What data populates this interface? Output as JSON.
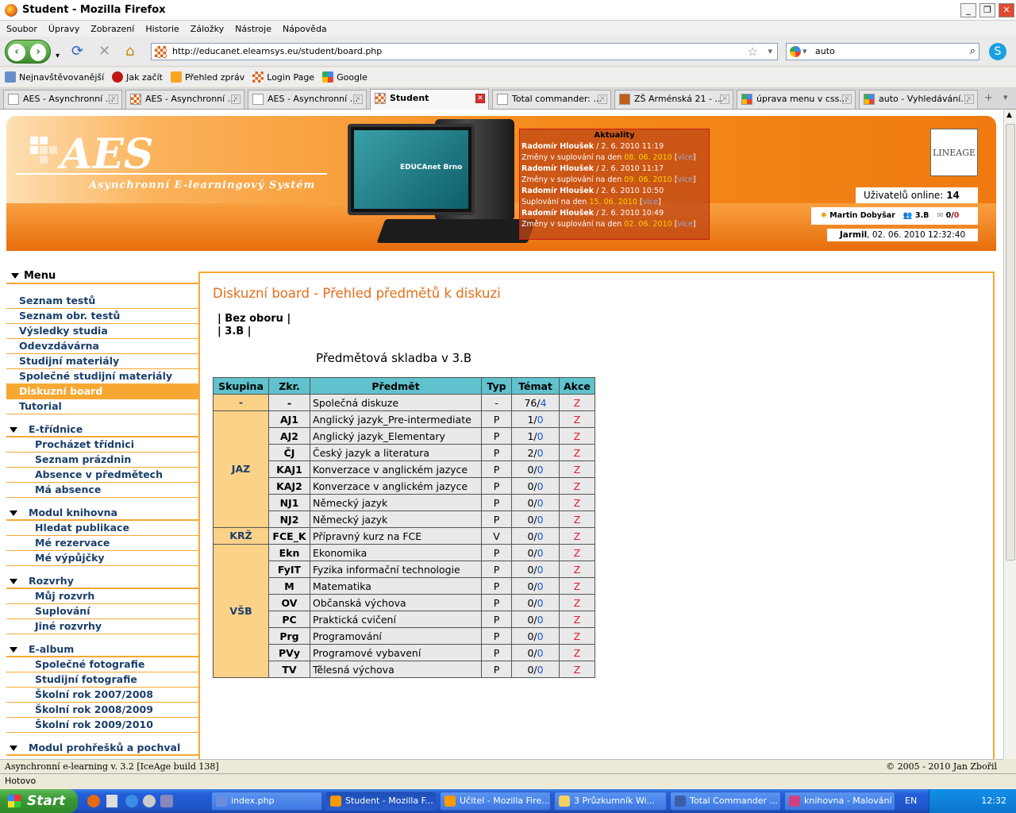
{
  "window": {
    "title": "Student - Mozilla Firefox"
  },
  "menubar": [
    "Soubor",
    "Úpravy",
    "Zobrazení",
    "Historie",
    "Záložky",
    "Nástroje",
    "Nápověda"
  ],
  "url": "http://educanet.elearnsys.eu/student/board.php",
  "search": "auto",
  "bookmarks": [
    "Nejnavštěvovanější",
    "Jak začít",
    "Přehled zpráv",
    "Login Page",
    "Google"
  ],
  "tabs": [
    "AES - Asynchronní ...",
    "AES - Asynchronní ...",
    "AES - Asynchronní ...",
    "Student",
    "Total commander: ...",
    "ZŠ Arménská 21 - ...",
    "úprava menu v css...",
    "auto - Vyhledávání..."
  ],
  "banner": {
    "logo": "AES",
    "subtitle": "Asynchronní E-learningový Systém",
    "monitor_text": "EDUCAnet Brno",
    "lineage": "LINEAGE",
    "news_title": "Aktuality",
    "news": [
      {
        "author": "Radomír Hloušek",
        "date": " / 2. 6. 2010 11:19",
        "text": "Změny v suplování na den ",
        "day": "08. 06. 2010",
        "more": "více"
      },
      {
        "author": "Radomír Hloušek",
        "date": " / 2. 6. 2010 11:17",
        "text": "Změny v suplování na den ",
        "day": "09. 06. 2010",
        "more": "více"
      },
      {
        "author": "Radomír Hloušek",
        "date": " / 2. 6. 2010 10:50",
        "text": "Suplování na den ",
        "day": "15. 06. 2010",
        "more": "více"
      },
      {
        "author": "Radomír Hloušek",
        "date": " / 2. 6. 2010 10:49",
        "text": "Změny v suplování na den ",
        "day": "02. 06. 2010",
        "more": "více"
      }
    ],
    "online_label": "Uživatelů online: ",
    "online_count": "14",
    "user_name": "Martin Dobyšar",
    "user_class": "3.B",
    "messages": "0/",
    "messages_new": "0",
    "date_user": "Jarmil",
    "date_text": ", 02. 06. 2010 12:32:40"
  },
  "sidebar": {
    "menu_title": "Menu",
    "items": [
      "Seznam testů",
      "Seznam obr. testů",
      "Výsledky studia",
      "Odevzdávárna",
      "Studijní materiály",
      "Společné studijní materiály",
      "Diskuzní board",
      "Tutorial"
    ],
    "groups": [
      {
        "title": "E-třídnice",
        "items": [
          "Procházet třídnici",
          "Seznam prázdnin",
          "Absence v předmětech",
          "Má absence"
        ]
      },
      {
        "title": "Modul knihovna",
        "items": [
          "Hledat publikace",
          "Mé rezervace",
          "Mé výpůjčky"
        ]
      },
      {
        "title": "Rozvrhy",
        "items": [
          "Můj rozvrh",
          "Suplování",
          "Jiné rozvrhy"
        ]
      },
      {
        "title": "E-album",
        "items": [
          "Společné fotografie",
          "Studijní fotografie",
          "Školní rok 2007/2008",
          "Školní rok 2008/2009",
          "Školní rok 2009/2010"
        ]
      },
      {
        "title": "Modul prohřešků a pochval",
        "items": []
      }
    ]
  },
  "main": {
    "title": "Diskuzní board - Přehled předmětů k diskuzi",
    "filter1": "Bez oboru",
    "filter2": "3.B",
    "table_title": "Předmětová skladba v 3.B",
    "headers": [
      "Skupina",
      "Zkr.",
      "Předmět",
      "Typ",
      "Témat",
      "Akce"
    ],
    "groups": [
      {
        "name": "-",
        "rows": [
          {
            "k": "-",
            "s": "Společná diskuze",
            "t": "-",
            "a": "76/",
            "n": "4"
          }
        ]
      },
      {
        "name": "JAZ",
        "rows": [
          {
            "k": "AJ1",
            "s": "Anglický jazyk_Pre-intermediate",
            "t": "P",
            "a": "1/",
            "n": "0"
          },
          {
            "k": "AJ2",
            "s": "Anglický jazyk_Elementary",
            "t": "P",
            "a": "1/",
            "n": "0"
          },
          {
            "k": "ČJ",
            "s": "Český jazyk a literatura",
            "t": "P",
            "a": "2/",
            "n": "0"
          },
          {
            "k": "KAJ1",
            "s": "Konverzace v anglickém jazyce",
            "t": "P",
            "a": "0/",
            "n": "0"
          },
          {
            "k": "KAJ2",
            "s": "Konverzace v anglickém jazyce",
            "t": "P",
            "a": "0/",
            "n": "0"
          },
          {
            "k": "NJ1",
            "s": "Německý jazyk",
            "t": "P",
            "a": "0/",
            "n": "0"
          },
          {
            "k": "NJ2",
            "s": "Německý jazyk",
            "t": "P",
            "a": "0/",
            "n": "0"
          }
        ]
      },
      {
        "name": "KRŽ",
        "rows": [
          {
            "k": "FCE_K",
            "s": "Přípravný kurz na FCE",
            "t": "V",
            "a": "0/",
            "n": "0"
          }
        ]
      },
      {
        "name": "VŠB",
        "rows": [
          {
            "k": "Ekn",
            "s": "Ekonomika",
            "t": "P",
            "a": "0/",
            "n": "0"
          },
          {
            "k": "FyIT",
            "s": "Fyzika informační technologie",
            "t": "P",
            "a": "0/",
            "n": "0"
          },
          {
            "k": "M",
            "s": "Matematika",
            "t": "P",
            "a": "0/",
            "n": "0"
          },
          {
            "k": "OV",
            "s": "Občanská výchova",
            "t": "P",
            "a": "0/",
            "n": "0"
          },
          {
            "k": "PC",
            "s": "Praktická cvičení",
            "t": "P",
            "a": "0/",
            "n": "0"
          },
          {
            "k": "Prg",
            "s": "Programování",
            "t": "P",
            "a": "0/",
            "n": "0"
          },
          {
            "k": "PVy",
            "s": "Programové vybavení",
            "t": "P",
            "a": "0/",
            "n": "0"
          },
          {
            "k": "TV",
            "s": "Tělesná výchova",
            "t": "P",
            "a": "0/",
            "n": "0"
          }
        ]
      }
    ],
    "action": "Z"
  },
  "footer": {
    "left": "Asynchronní e-learning  v. 3.2 [IceAge build 138]",
    "right": "© 2005 - 2010  Jan Zbořil"
  },
  "status": "Hotovo",
  "taskbar": {
    "start": "Start",
    "tasks": [
      "index.php",
      "Student - Mozilla F...",
      "Učitel - Mozilla Fire...",
      "3 Průzkumník Wi...",
      "Total Commander ...",
      "knihovna - Malování"
    ],
    "lang": "EN",
    "clock": "12:32"
  }
}
